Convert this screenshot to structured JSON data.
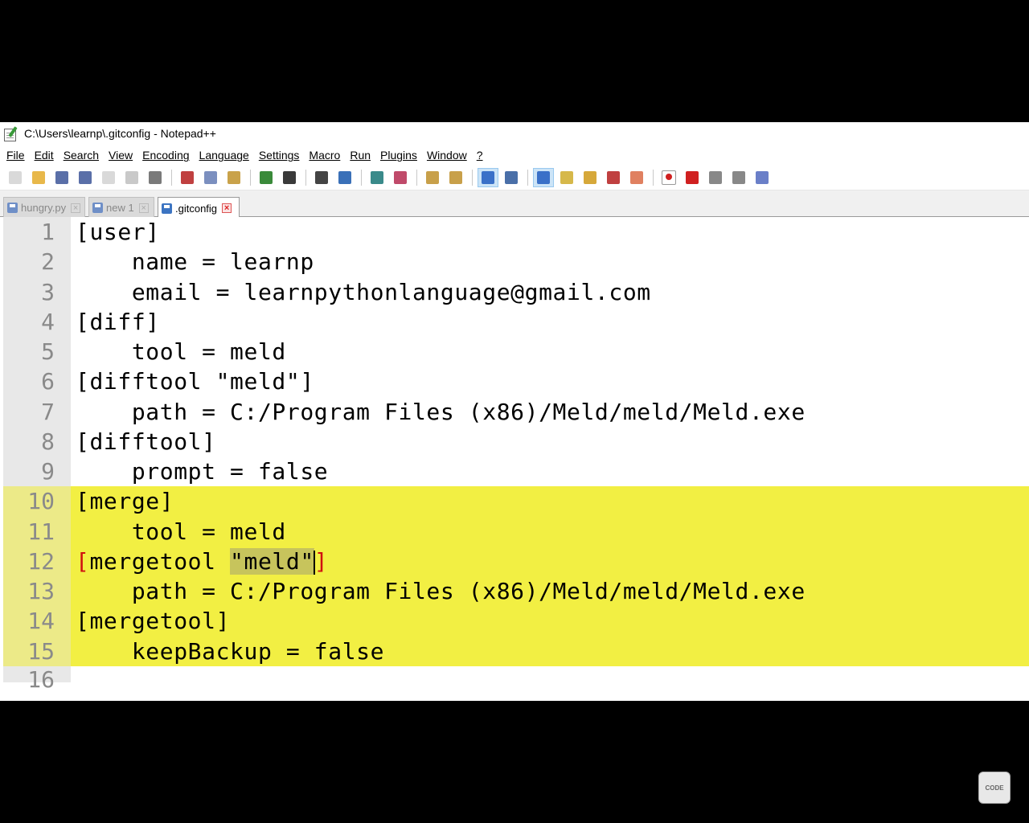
{
  "window": {
    "title": "C:\\Users\\learnp\\.gitconfig - Notepad++"
  },
  "menu": [
    {
      "label": "File"
    },
    {
      "label": "Edit"
    },
    {
      "label": "Search"
    },
    {
      "label": "View"
    },
    {
      "label": "Encoding"
    },
    {
      "label": "Language"
    },
    {
      "label": "Settings"
    },
    {
      "label": "Macro"
    },
    {
      "label": "Run"
    },
    {
      "label": "Plugins"
    },
    {
      "label": "Window"
    },
    {
      "label": "?"
    }
  ],
  "toolbar": {
    "icons": [
      "new-file-icon",
      "open-file-icon",
      "save-icon",
      "save-all-icon",
      "close-icon",
      "close-all-icon",
      "print-icon",
      "cut-icon",
      "copy-icon",
      "paste-icon",
      "undo-icon",
      "redo-icon",
      "find-icon",
      "replace-icon",
      "zoom-in-icon",
      "zoom-out-icon",
      "sync-vertical-icon",
      "sync-horizontal-icon",
      "word-wrap-icon",
      "show-all-chars-icon",
      "indent-guide-icon",
      "doc-map-icon",
      "function-list-icon",
      "folder-workspace-icon",
      "monitor-icon",
      "record-macro-icon",
      "stop-macro-icon",
      "play-macro-icon",
      "run-macro-multiple-icon",
      "save-macro-icon"
    ]
  },
  "tabs": [
    {
      "label": "hungry.py",
      "active": false
    },
    {
      "label": "new 1",
      "active": false
    },
    {
      "label": ".gitconfig",
      "active": true
    }
  ],
  "editor": {
    "lines": [
      {
        "num": "1",
        "text": "[user]"
      },
      {
        "num": "2",
        "text": "    name = learnp"
      },
      {
        "num": "3",
        "text": "    email = learnpythonlanguage@gmail.com"
      },
      {
        "num": "4",
        "text": "[diff]"
      },
      {
        "num": "5",
        "text": "    tool = meld"
      },
      {
        "num": "6",
        "text": "[difftool \"meld\"]"
      },
      {
        "num": "7",
        "text": "    path = C:/Program Files (x86)/Meld/meld/Meld.exe"
      },
      {
        "num": "8",
        "text": "[difftool]"
      },
      {
        "num": "9",
        "text": "    prompt = false"
      },
      {
        "num": "10",
        "text": "[merge]"
      },
      {
        "num": "11",
        "text": "    tool = meld"
      },
      {
        "num": "12",
        "pre": "mergetool ",
        "sel": "\"meld\"",
        "post": ""
      },
      {
        "num": "13",
        "text": "    path = C:/Program Files (x86)/Meld/meld/Meld.exe"
      },
      {
        "num": "14",
        "text": "[mergetool]"
      },
      {
        "num": "15",
        "text": "    keepBackup = false"
      },
      {
        "num": "16",
        "text": ""
      }
    ],
    "brace_open": "[",
    "brace_close": "]",
    "highlight_color": "#f2ef43"
  },
  "logo": {
    "text": "CODE BASICS"
  }
}
